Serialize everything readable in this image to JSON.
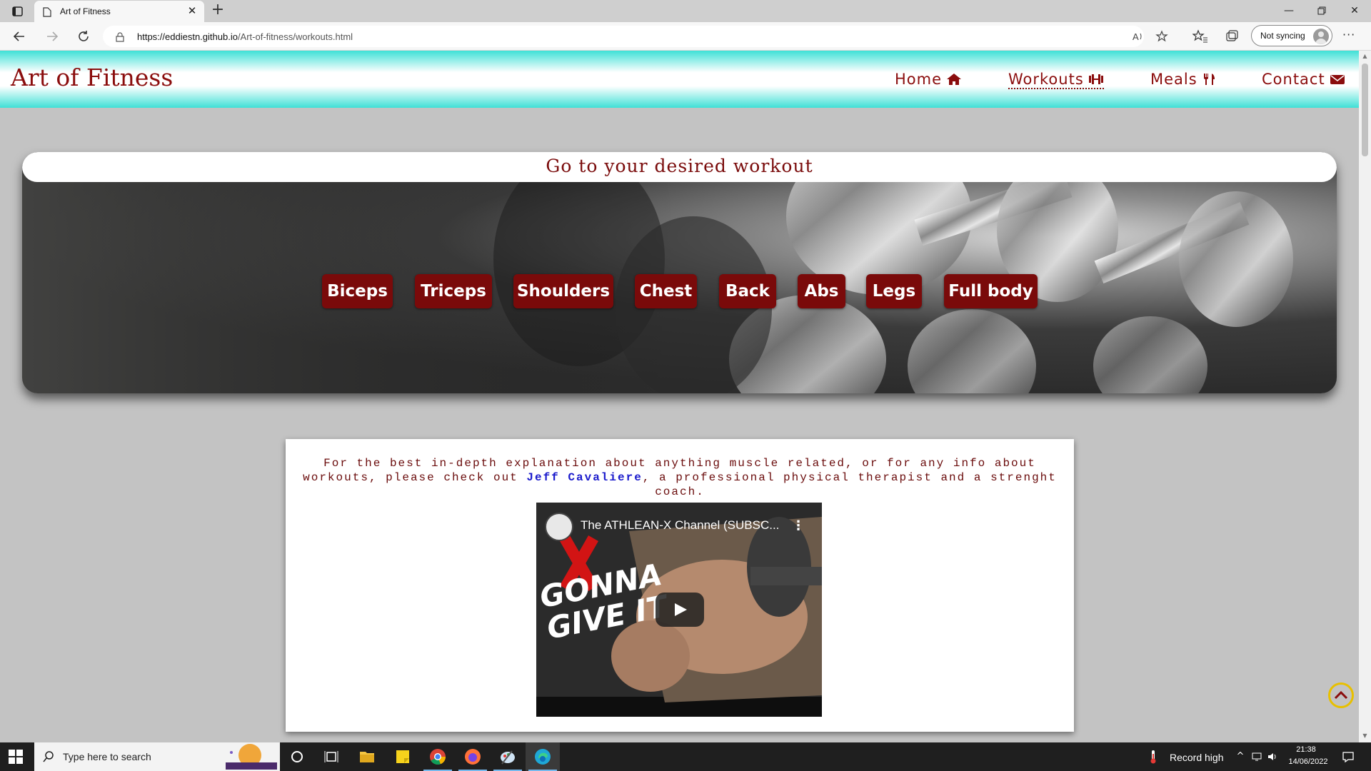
{
  "browser": {
    "tab_title": "Art of Fitness",
    "url_host": "https://eddiestn.github.io",
    "url_path": "/Art-of-fitness/workouts.html",
    "profile_label": "Not syncing",
    "more_label": "···"
  },
  "site": {
    "brand": "Art of Fitness",
    "nav": [
      {
        "label": "Home",
        "icon": "home-icon",
        "active": false
      },
      {
        "label": "Workouts",
        "icon": "dumbbell-icon",
        "active": true
      },
      {
        "label": "Meals",
        "icon": "utensils-icon",
        "active": false
      },
      {
        "label": "Contact",
        "icon": "envelope-icon",
        "active": false
      }
    ],
    "hero_title": "Go to your desired workout",
    "workouts": [
      "Biceps",
      "Triceps",
      "Shoulders",
      "Chest",
      "Back",
      "Abs",
      "Legs",
      "Full body"
    ],
    "info_text_before": "For the best in-depth explanation about anything muscle related, or for any info about workouts, please check out",
    "info_link": "Jeff Cavaliere",
    "info_text_after": ", a professional physical therapist and a strenght coach.",
    "video": {
      "title": "The ATHLEAN-X Channel (SUBSC...",
      "overlay_line1": "GONNA",
      "overlay_line2": "GIVE IT"
    }
  },
  "colors": {
    "brand": "#8a0d0d",
    "header_accent": "#3fe0d6",
    "button_bg": "#7a0a0a",
    "link": "#1a1acc",
    "to_top": "#e8c000"
  },
  "taskbar": {
    "search_placeholder": "Type here to search",
    "weather_text": "Record high",
    "time": "21:38",
    "date": "14/06/2022"
  }
}
